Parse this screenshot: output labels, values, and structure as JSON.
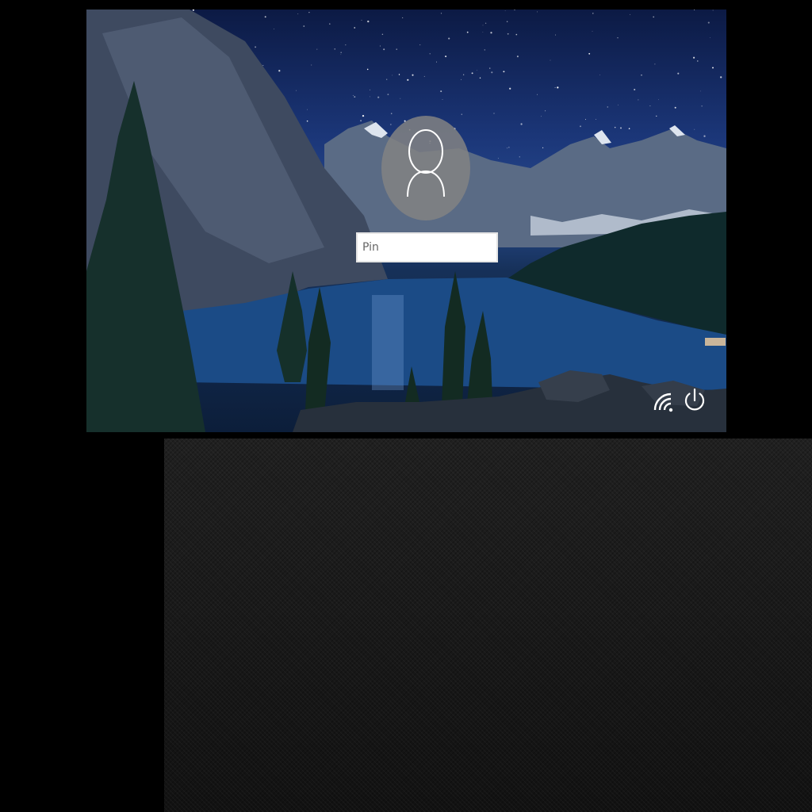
{
  "lock_screen": {
    "pin_placeholder": "Pin",
    "pin_value": ""
  },
  "icons": {
    "user": "user-avatar-icon",
    "network": "network-icon",
    "power": "power-icon"
  },
  "colors": {
    "sky_top": "#0c1a44",
    "lake": "#1b4b86",
    "avatar_bg": "#828282",
    "panel_bg": "#161616"
  }
}
